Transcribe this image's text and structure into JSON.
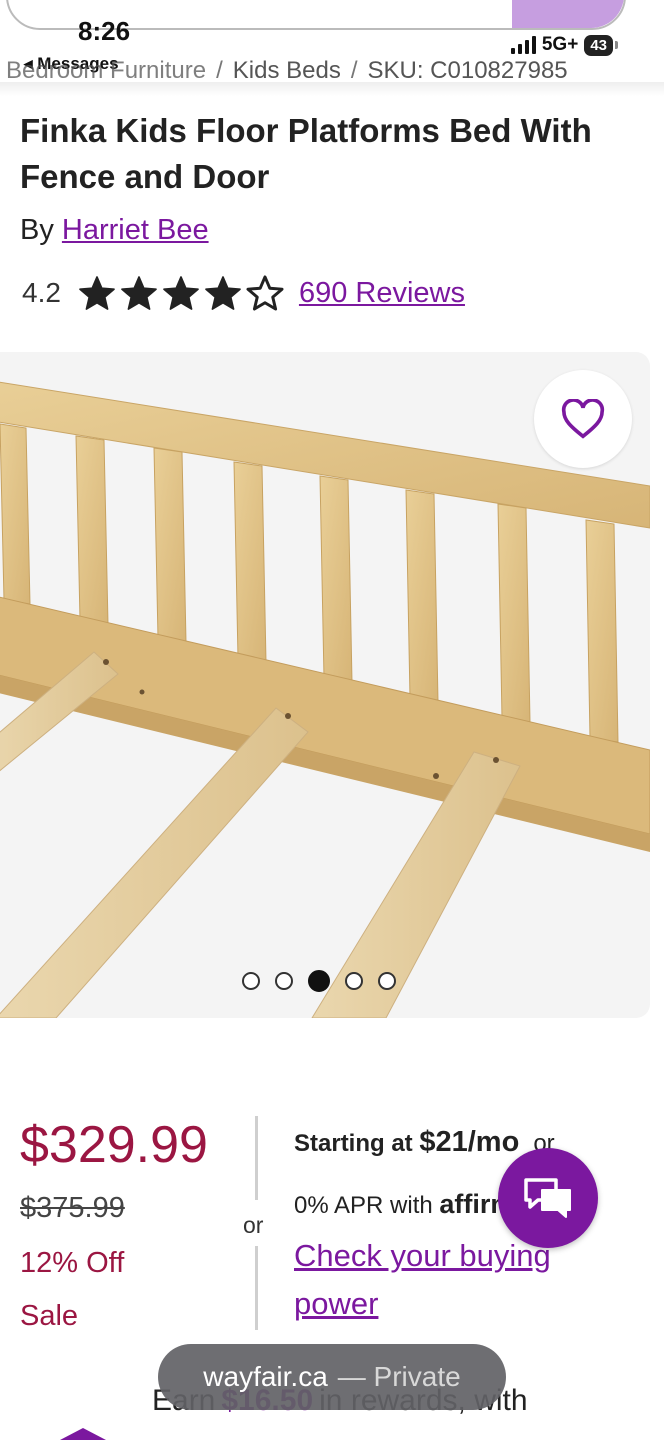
{
  "status_bar": {
    "time": "8:26",
    "back_label": "◂ Messages",
    "network": "5G+",
    "battery": "43"
  },
  "breadcrumb": {
    "items": [
      "Bedroom Furniture",
      "Kids Beds",
      "SKU: C010827985"
    ],
    "separator": "/"
  },
  "product": {
    "title": "Finka Kids Floor Platforms Bed With Fence and Door",
    "by_prefix": "By",
    "brand": "Harriet Bee",
    "rating": "4.2",
    "rating_value": 4.2,
    "stars_filled": 4,
    "stars_total": 5,
    "reviews_label": "690 Reviews"
  },
  "gallery": {
    "favorite_icon": "heart-outline-icon",
    "image_count": 5,
    "active_index": 2
  },
  "pricing": {
    "price": "$329.99",
    "was_price": "$375.99",
    "discount": "12% Off",
    "sale_label": "Sale",
    "or_label": "or"
  },
  "financing": {
    "starting_prefix": "Starting at",
    "monthly": "$21/mo",
    "or_label": "or",
    "apr_text": "0% APR with",
    "provider": "affirm",
    "check_link": "Check your buying power"
  },
  "rewards": {
    "prefix": "Earn",
    "amount": "$16.50",
    "suffix": "in rewards, with"
  },
  "browser": {
    "domain": "wayfair.ca",
    "mode": "— Private"
  },
  "colors": {
    "brand_purple": "#7b189f",
    "price_red": "#9b1642"
  }
}
